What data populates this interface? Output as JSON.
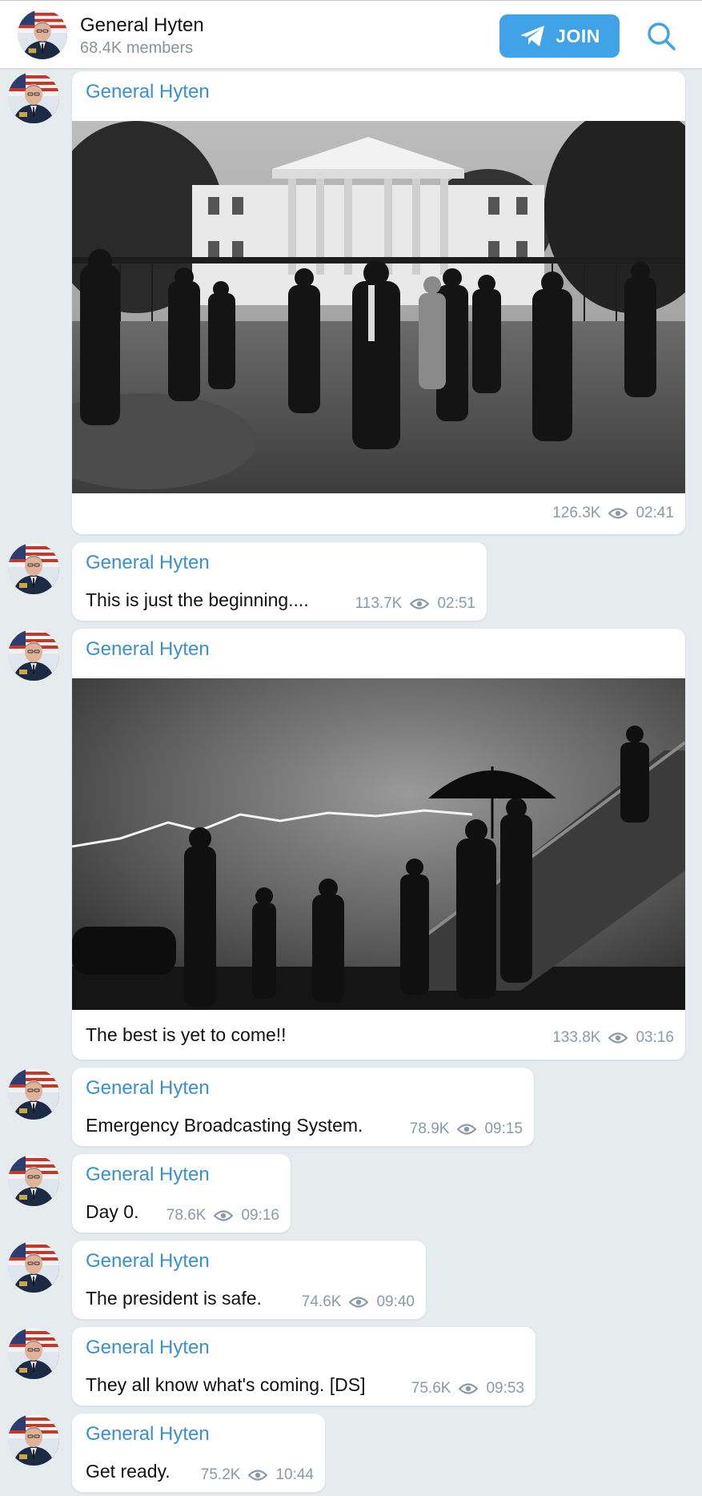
{
  "channel": {
    "name": "General Hyten",
    "members": "68.4K members",
    "join_label": "JOIN"
  },
  "icons": {
    "header_join": "telegram-plane-icon",
    "header_search": "search-icon",
    "views": "eye-icon"
  },
  "colors": {
    "accent": "#40a3e7",
    "sender": "#3a8fcf",
    "background": "#e6ebee",
    "meta": "#8a9aa8"
  },
  "messages": [
    {
      "sender": "General Hyten",
      "text": "",
      "views": "126.3K",
      "time": "02:41",
      "has_photo": true
    },
    {
      "sender": "General Hyten",
      "text": "This is just the beginning....",
      "views": "113.7K",
      "time": "02:51",
      "has_photo": false
    },
    {
      "sender": "General Hyten",
      "text": "The best is yet to come!!",
      "views": "133.8K",
      "time": "03:16",
      "has_photo": true
    },
    {
      "sender": "General Hyten",
      "text": "Emergency Broadcasting System.",
      "views": "78.9K",
      "time": "09:15",
      "has_photo": false
    },
    {
      "sender": "General Hyten",
      "text": "Day 0.",
      "views": "78.6K",
      "time": "09:16",
      "has_photo": false
    },
    {
      "sender": "General Hyten",
      "text": "The president is safe.",
      "views": "74.6K",
      "time": "09:40",
      "has_photo": false
    },
    {
      "sender": "General Hyten",
      "text": "They all know what's coming. [DS]",
      "views": "75.6K",
      "time": "09:53",
      "has_photo": false
    },
    {
      "sender": "General Hyten",
      "text": "Get ready.",
      "views": "75.2K",
      "time": "10:44",
      "has_photo": false
    }
  ]
}
